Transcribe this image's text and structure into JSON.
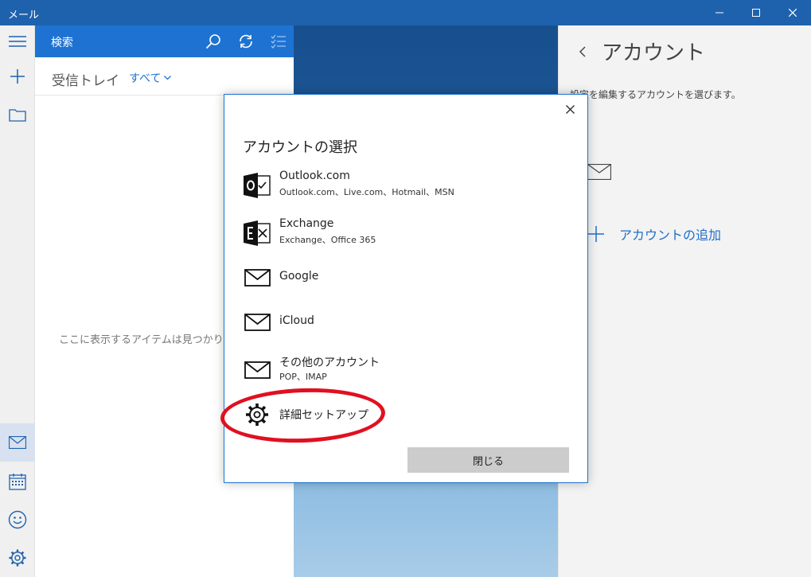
{
  "window": {
    "title": "メール"
  },
  "rail": {
    "items": [
      "hamburger-menu",
      "new-mail",
      "folders",
      "mail",
      "calendar",
      "feedback",
      "settings"
    ]
  },
  "list_pane": {
    "search_label": "検索",
    "folder_name": "受信トレイ",
    "filter_label": "すべて",
    "empty_message": "ここに表示するアイテムは見つかりませ"
  },
  "account_pane": {
    "title": "アカウント",
    "description": "設定を編集するアカウントを選びます。",
    "add_account_label": "アカウントの追加"
  },
  "dialog": {
    "title": "アカウントの選択",
    "options": [
      {
        "name": "Outlook.com",
        "sub": "Outlook.com、Live.com、Hotmail、MSN",
        "icon": "outlook-icon"
      },
      {
        "name": "Exchange",
        "sub": "Exchange、Office 365",
        "icon": "exchange-icon"
      },
      {
        "name": "Google",
        "icon": "envelope-icon"
      },
      {
        "name": "iCloud",
        "icon": "envelope-icon"
      },
      {
        "name": "その他のアカウント",
        "sub": "POP、IMAP",
        "icon": "envelope-icon"
      },
      {
        "name": "詳細セットアップ",
        "icon": "gear-icon"
      }
    ],
    "close_button": "閉じる"
  },
  "colors": {
    "titlebar": "#1e62ad",
    "search_bar": "#1e73d2",
    "accent_link": "#1e6ec8",
    "highlight": "#e01020"
  }
}
